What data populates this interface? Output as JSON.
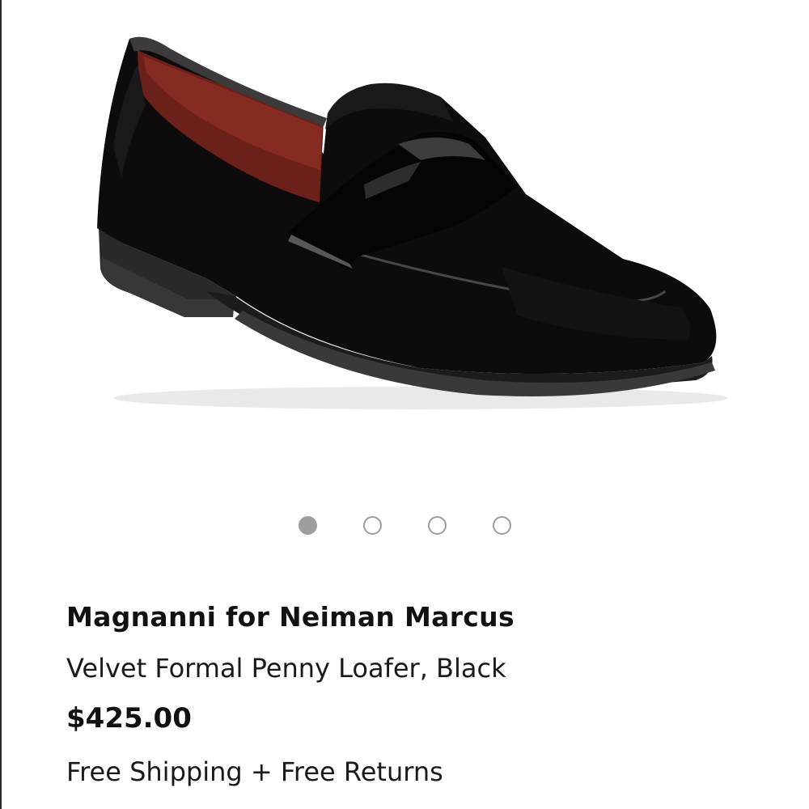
{
  "product": {
    "brand": "Magnanni for Neiman Marcus",
    "name": "Velvet Formal Penny Loafer, Black",
    "price": "$425.00",
    "shipping": "Free Shipping + Free Returns",
    "image_icon": "black-velvet-penny-loafer-image"
  },
  "carousel": {
    "total": 4,
    "active_index": 0
  },
  "colors": {
    "dot_active": "#9e9e9e",
    "dot_inactive_border": "#9e9e9e",
    "shoe_body": "#0d0b0b",
    "shoe_lining": "#7a2a22"
  }
}
